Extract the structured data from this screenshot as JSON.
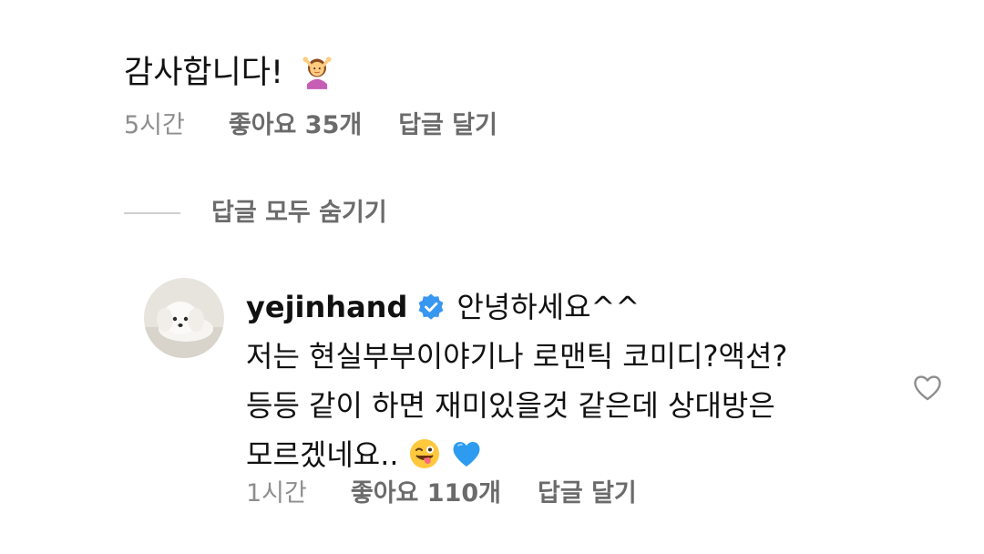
{
  "parent_comment": {
    "text": "감사합니다!",
    "emoji": "woman-gesturing-ok-emoji",
    "time": "5시간",
    "likes": "좋아요 35개",
    "reply_label": "답글 달기"
  },
  "replies_toggle": {
    "label": "답글 모두 숨기기"
  },
  "reply_comment": {
    "username": "yejinhand",
    "verified": true,
    "lines": [
      "안녕하세요^^",
      "저는 현실부부이야기나 로맨틱 코미디?액션?",
      "등등 같이 하면 재미있을것 같은데 상대방은",
      "모르겠네요.."
    ],
    "trailing_emojis": [
      "winking-face-with-tongue-emoji",
      "blue-heart-emoji"
    ],
    "time": "1시간",
    "likes": "좋아요 110개",
    "reply_label": "답글 달기",
    "avatar": "white-puppy-avatar"
  },
  "colors": {
    "text_primary": "#111111",
    "text_secondary": "#6b6b6b",
    "text_muted": "#8e8e8e",
    "verified_blue": "#3897f0",
    "divider": "#cfcfcf"
  }
}
